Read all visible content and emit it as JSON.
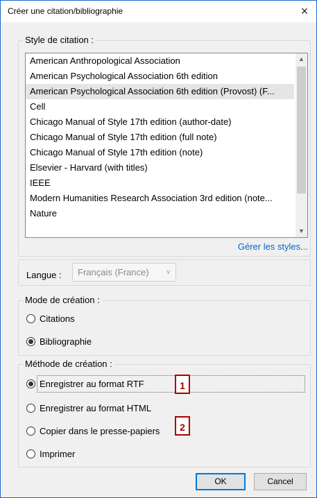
{
  "window": {
    "title": "Créer une citation/bibliographie",
    "close_icon": "×"
  },
  "citation_style": {
    "label": "Style de citation :",
    "items": [
      "American Anthropological Association",
      "American Psychological Association 6th edition",
      "American Psychological Association 6th edition (Provost) (F...",
      "Cell",
      "Chicago Manual of Style 17th edition (author-date)",
      "Chicago Manual of Style 17th edition (full note)",
      "Chicago Manual of Style 17th edition (note)",
      "Elsevier - Harvard (with titles)",
      "IEEE",
      "Modern Humanities Research Association 3rd edition (note...",
      "Nature"
    ],
    "selected_index": 2,
    "manage_link": "Gérer les styles..."
  },
  "language": {
    "label": "Langue :",
    "value": "Français (France)"
  },
  "creation_mode": {
    "label": "Mode de création :",
    "options": [
      "Citations",
      "Bibliographie"
    ],
    "selected": "Bibliographie"
  },
  "creation_method": {
    "label": "Méthode de création :",
    "options": [
      "Enregistrer au format RTF",
      "Enregistrer au format HTML",
      "Copier dans le presse-papiers",
      "Imprimer"
    ],
    "selected": "Enregistrer au format RTF"
  },
  "callouts": [
    "1",
    "2"
  ],
  "buttons": {
    "ok": "OK",
    "cancel": "Cancel"
  },
  "colors": {
    "accent": "#0078d7",
    "callout": "#a80000",
    "link": "#0066cc"
  }
}
